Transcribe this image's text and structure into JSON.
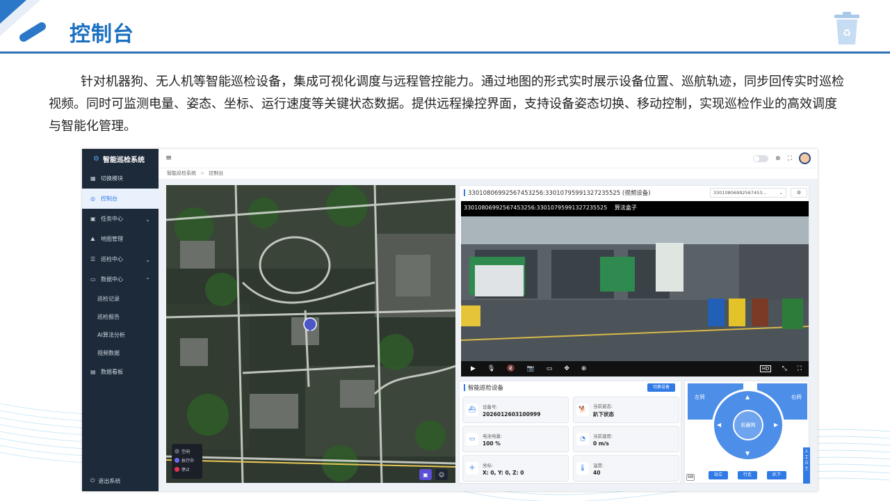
{
  "slide": {
    "title": "控制台",
    "intro": "针对机器狗、无人机等智能巡检设备，集成可视化调度与远程管控能力。通过地图的形式实时展示设备位置、巡航轨迹，同步回传实时巡检视频。同时可监测电量、姿态、坐标、运行速度等关键状态数据。提供远程操控界面，支持设备姿态切换、移动控制，实现巡检作业的高效调度与智能化管理。",
    "logo_icon": "recycle-bin-icon"
  },
  "sidebar": {
    "brand": "智能巡检系统",
    "items": [
      {
        "label": "切换模块",
        "icon": "grid-icon"
      },
      {
        "label": "控制台",
        "icon": "dashboard-icon",
        "active": true
      },
      {
        "label": "任务中心",
        "icon": "calendar-icon",
        "expandable": true
      },
      {
        "label": "地图管理",
        "icon": "map-icon"
      },
      {
        "label": "巡检中心",
        "icon": "list-icon",
        "expandable": true
      },
      {
        "label": "数据中心",
        "icon": "monitor-icon",
        "expanded": true
      }
    ],
    "sub_items": [
      "巡检记录",
      "巡检报告",
      "AI算法分析",
      "视频数据"
    ],
    "extra_item": {
      "label": "数据看板",
      "icon": "board-icon"
    },
    "logout": "退出系统"
  },
  "topbar": {
    "breadcrumbs": [
      "智能巡检系统",
      "控制台"
    ],
    "separator": ">"
  },
  "map": {
    "legend": [
      {
        "label": "空闲",
        "color": "#555b6e"
      },
      {
        "label": "执行中",
        "color": "#6b6cf0"
      },
      {
        "label": "停止",
        "color": "#e5334f"
      }
    ]
  },
  "video": {
    "title": "33010806992567453256:33010795991327235525 (视频设备)",
    "selected_device": "33010806992567453...",
    "caption": "33010806992567453256:33010795991327235525",
    "caption_tag": "算法盒子",
    "hd_label": "HD"
  },
  "device": {
    "title": "智能巡检设备",
    "switch_label": "切换设备",
    "cards": [
      {
        "label": "设备号:",
        "value": "2026012603100999",
        "icon": "ship-icon"
      },
      {
        "label": "当前姿态:",
        "value": "趴下状态",
        "icon": "dog-icon"
      },
      {
        "label": "电池电量:",
        "value": "100 %",
        "icon": "battery-icon"
      },
      {
        "label": "当前速度:",
        "value": "0 m/s",
        "icon": "gauge-icon"
      },
      {
        "label": "坐标:",
        "value": "X: 0, Y: 0, Z: 0",
        "icon": "coordinate-icon"
      },
      {
        "label": "温度:",
        "value": "40",
        "icon": "thermometer-icon"
      }
    ]
  },
  "control": {
    "turn_left": "左转",
    "turn_right": "右转",
    "center": "机器狗",
    "buttons": [
      "站立",
      "行走",
      "趴下"
    ],
    "mode_tab": "人工",
    "mode_tab_alt": "自主"
  }
}
